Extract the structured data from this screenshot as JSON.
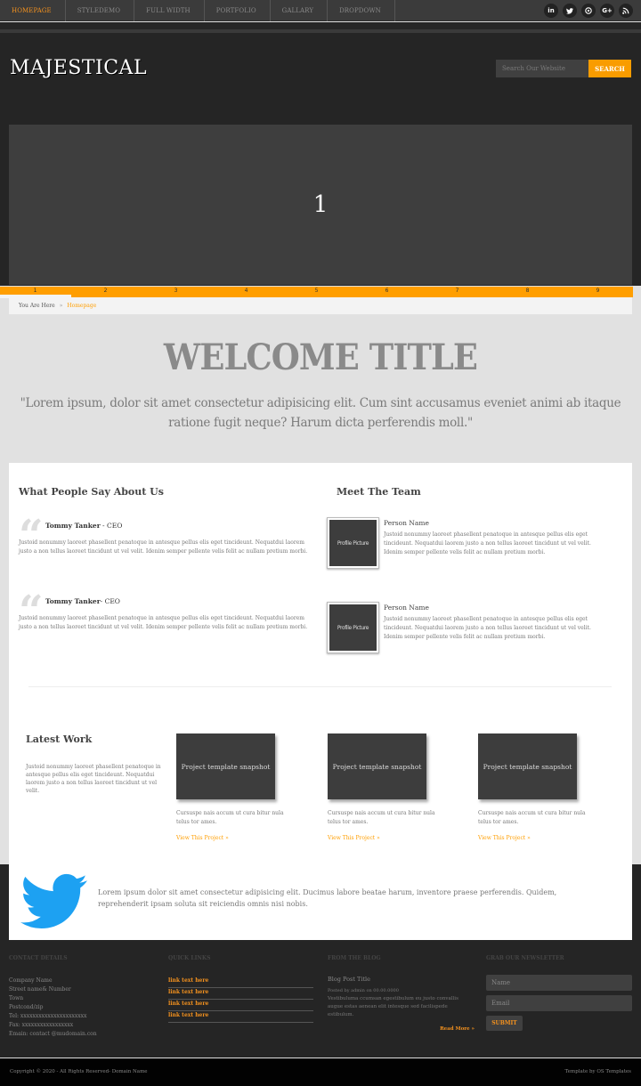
{
  "topnav": {
    "items": [
      {
        "label": "HOMEPAGE",
        "active": true
      },
      {
        "label": "STYLEDEMO",
        "active": false
      },
      {
        "label": "FULL WIDTH",
        "active": false
      },
      {
        "label": "PORTFOLIO",
        "active": false
      },
      {
        "label": "GALLARY",
        "active": false
      },
      {
        "label": "DROPDOWN",
        "active": false
      }
    ],
    "social": [
      {
        "icon": "linkedin-icon",
        "glyph": "in"
      },
      {
        "icon": "twitter-icon",
        "glyph": "t"
      },
      {
        "icon": "pinterest-icon",
        "glyph": "p"
      },
      {
        "icon": "google-plus-icon",
        "glyph": "G+"
      },
      {
        "icon": "rss-icon",
        "glyph": "☰"
      }
    ]
  },
  "header": {
    "logo": "MAJESTICAL",
    "search_placeholder": "Search Our Website",
    "search_button": "SEARCH"
  },
  "slider": {
    "current_slide": "1",
    "pages": [
      "1",
      "2",
      "3",
      "4",
      "5",
      "6",
      "7",
      "8",
      "9"
    ],
    "active_page": "1"
  },
  "breadcrumb": {
    "label": "You Are Here",
    "separator": "»",
    "current": "Homepage"
  },
  "welcome": {
    "title": "WELCOME TITLE",
    "quote": "\"Lorem ipsum, dolor sit amet consectetur adipisicing elit. Cum sint accusamus eveniet animi ab itaque ratione fugit neque? Harum dicta perferendis moll.\""
  },
  "testimonials": {
    "title": "What People Say About Us",
    "items": [
      {
        "name": "Tommy Tanker",
        "role": " - CEO",
        "body": "Justoid nonummy laoreet phasellent penatoque in antesque pellus elis eget tincideunt. Nequatdui laorem justo a non tellus laoreet tincidunt ut vel velit. Idenim semper pellente velis felit ac nullam pretium morbi."
      },
      {
        "name": "Tommy Tanker",
        "role": "- CEO",
        "body": "Justoid nonummy laoreet phasellent penatoque in antesque pellus elis eget tincideunt. Nequatdui laorem justo a non tellus laoreet tincidunt ut vel velit. Idenim semper pellente velis felit ac nullam pretium morbi."
      }
    ]
  },
  "team": {
    "title": "Meet The Team",
    "members": [
      {
        "picture_label": "Profile Picture",
        "name": "Person Name",
        "body": "Justoid nonummy laoreet phasellent penatoque in antesque pellus elis eget tincideunt. Nequatdui laorem justo a non tellus laoreet tincidunt ut vel velit. Idenim semper pellente velis felit ac nullam pretium morbi."
      },
      {
        "picture_label": "Profile Picture",
        "name": "Person Name",
        "body": "Justoid nonummy laoreet phasellent penatoque in antesque pellus elis eget tincideunt. Nequatdui laorem justo a non tellus laoreet tincidunt ut vel velit. Idenim semper pellente velis felit ac nullam pretium morbi."
      }
    ]
  },
  "latest_work": {
    "title": "Latest Work",
    "body": "Justoid nonummy laoreet phasellent penatoque in antesque pellus elis eget tincideunt. Nequatdui laorem justo a non tellus laoreet tincidunt ut vel velit.",
    "projects": [
      {
        "snapshot": "Project template snapshot",
        "desc": "Cursuspe nais accum ut cura bitur nula telus tor ames.",
        "link": "View This Project »"
      },
      {
        "snapshot": "Project template snapshot",
        "desc": "Cursuspe nais accum ut cura bitur nula telus tor ames.",
        "link": "View This Project »"
      },
      {
        "snapshot": "Project template snapshot",
        "desc": "Cursuspe nais accum ut cura bitur nula telus tor ames.",
        "link": "View This Project »"
      }
    ]
  },
  "twitter": {
    "text": "Lorem ipsum dolor sit amet consectetur adipisicing elit. Ducimus labore beatae harum, inventore praese perferendis. Quidem, reprehenderit ipsam soluta sit reiciendis omnis nisi nobis."
  },
  "footer": {
    "contact": {
      "heading": "CONTACT DETAILS",
      "lines": [
        "Company Name",
        "Street name& Number",
        "Town",
        "Postcond/zip",
        "Tel: xxxxxxxxxxxxxxxxxxxxxx",
        "Fax: xxxxxxxxxxxxxxxxx",
        "Emain: contact @mudomain.con"
      ]
    },
    "quick_links": {
      "heading": "QUICK LINKS",
      "links": [
        "link text here",
        "link text here",
        "link text here",
        "link text here"
      ]
    },
    "blog": {
      "heading": "FROM THE BLOG",
      "post_title": "Blog Post Title",
      "meta": "Posted by admin on 00.00.0000",
      "body": "Vestibuluma ccumsan egestibulum eu justo convallis augue estas aenean elit intesque sed facilispede estibulum.",
      "read_more": "Read More »"
    },
    "newsletter": {
      "heading": "GRAB OUR NEWSLETTER",
      "name_placeholder": "Name",
      "email_placeholder": "Email",
      "submit": "SUBMIT"
    }
  },
  "bottom": {
    "copyright": "Copyright © 2020 - All Rights Reserved- Domain Name",
    "credit": "Template by OS Templates"
  },
  "colors": {
    "accent": "#ff9e00",
    "dark_bg": "#252525",
    "twitter_blue": "#1da1f2"
  }
}
